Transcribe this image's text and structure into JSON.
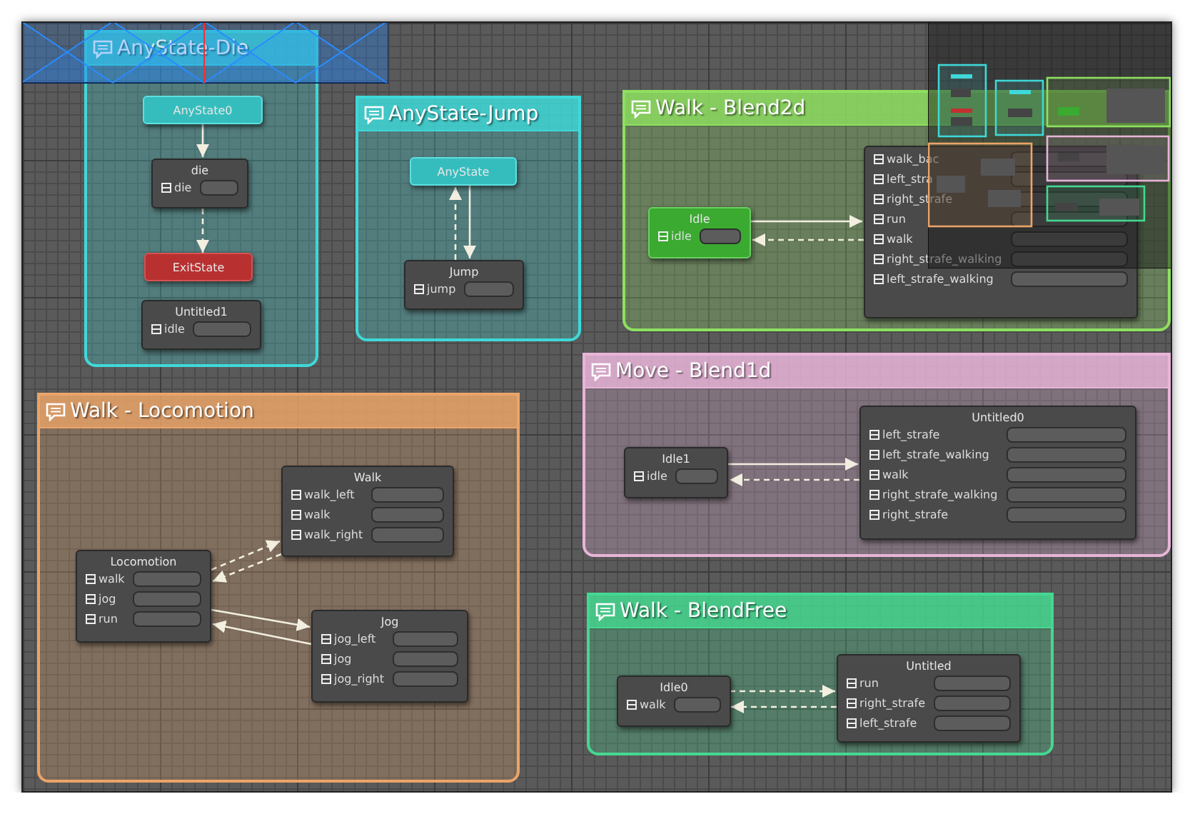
{
  "groups": [
    {
      "title": "AnyState-Die",
      "color": "#3fd8d8",
      "nodes": [
        {
          "kind": "any",
          "title": "AnyState0"
        },
        {
          "kind": "state",
          "title": "die",
          "rows": [
            "die"
          ]
        },
        {
          "kind": "exit",
          "title": "ExitState"
        },
        {
          "kind": "state",
          "title": "Untitled1",
          "rows": [
            "idle"
          ]
        }
      ]
    },
    {
      "title": "AnyState-Jump",
      "color": "#3fd8d8",
      "nodes": [
        {
          "kind": "any",
          "title": "AnyState"
        },
        {
          "kind": "state",
          "title": "Jump",
          "rows": [
            "jump"
          ]
        }
      ]
    },
    {
      "title": "Walk - Blend2d",
      "color": "#8ee060",
      "nodes": [
        {
          "kind": "entry",
          "title": "Idle",
          "rows": [
            "idle"
          ]
        },
        {
          "kind": "state",
          "rows": [
            "walk_bac",
            "left_stra",
            "right_strafe",
            "run",
            "walk",
            "right_strafe_walking",
            "left_strafe_walking"
          ]
        }
      ]
    },
    {
      "title": "Walk - Locomotion",
      "color": "#eaa468",
      "nodes": [
        {
          "kind": "state",
          "title": "Locomotion",
          "rows": [
            "walk",
            "jog",
            "run"
          ]
        },
        {
          "kind": "state",
          "title": "Walk",
          "rows": [
            "walk_left",
            "walk",
            "walk_right"
          ]
        },
        {
          "kind": "state",
          "title": "Jog",
          "rows": [
            "jog_left",
            "jog",
            "jog_right"
          ]
        }
      ]
    },
    {
      "title": "Move - Blend1d",
      "color": "#e8b4d8",
      "nodes": [
        {
          "kind": "state",
          "title": "Idle1",
          "rows": [
            "idle"
          ]
        },
        {
          "kind": "state",
          "title": "Untitled0",
          "rows": [
            "left_strafe",
            "left_strafe_walking",
            "walk",
            "right_strafe_walking",
            "right_strafe"
          ]
        }
      ]
    },
    {
      "title": "Walk - BlendFree",
      "color": "#44d890",
      "nodes": [
        {
          "kind": "state",
          "title": "Idle0",
          "rows": [
            "walk"
          ]
        },
        {
          "kind": "state",
          "title": "Untitled",
          "rows": [
            "run",
            "right_strafe",
            "left_strafe"
          ]
        }
      ]
    }
  ]
}
